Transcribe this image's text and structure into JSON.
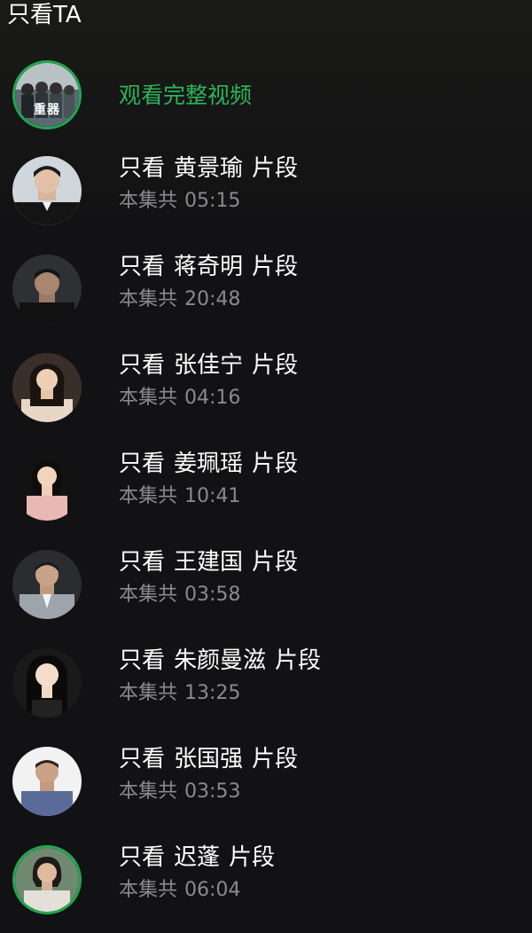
{
  "header": {
    "title": "只看TA"
  },
  "full_video": {
    "label": "观看完整视频",
    "badge": "重器",
    "accent_color": "#2db558"
  },
  "items": [
    {
      "prefix": "只看",
      "name": "黄景瑜",
      "suffix": "片段",
      "sub_prefix": "本集共",
      "duration": "05:15"
    },
    {
      "prefix": "只看",
      "name": "蒋奇明",
      "suffix": "片段",
      "sub_prefix": "本集共",
      "duration": "20:48"
    },
    {
      "prefix": "只看",
      "name": "张佳宁",
      "suffix": "片段",
      "sub_prefix": "本集共",
      "duration": "04:16"
    },
    {
      "prefix": "只看",
      "name": "姜珮瑶",
      "suffix": "片段",
      "sub_prefix": "本集共",
      "duration": "10:41"
    },
    {
      "prefix": "只看",
      "name": "王建国",
      "suffix": "片段",
      "sub_prefix": "本集共",
      "duration": "03:58"
    },
    {
      "prefix": "只看",
      "name": "朱颜曼滋",
      "suffix": "片段",
      "sub_prefix": "本集共",
      "duration": "13:25"
    },
    {
      "prefix": "只看",
      "name": "张国强",
      "suffix": "片段",
      "sub_prefix": "本集共",
      "duration": "03:53"
    },
    {
      "prefix": "只看",
      "name": "迟蓬",
      "suffix": "片段",
      "sub_prefix": "本集共",
      "duration": "06:04"
    }
  ]
}
